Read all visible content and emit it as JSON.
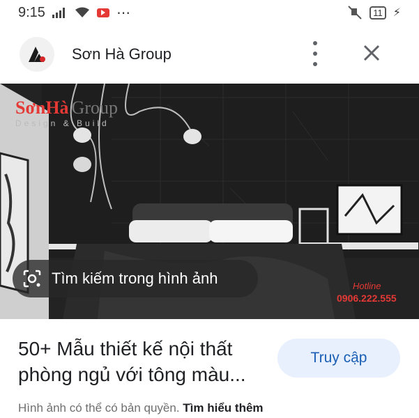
{
  "status_bar": {
    "time": "9:15",
    "battery": "11"
  },
  "header": {
    "site_name": "Sơn Hà Group"
  },
  "image": {
    "brand_text": "SơnHà",
    "brand_suffix": "Group",
    "brand_tagline": "Design & Build",
    "hotline_label": "Hotline",
    "hotline_number": "0906.222.555"
  },
  "lens": {
    "label": "Tìm kiếm trong hình ảnh"
  },
  "result": {
    "title_line1": "50+ Mẫu thiết kế nội thất",
    "title_line2": "phòng ngủ với tông màu...",
    "visit_label": "Truy cập",
    "copyright_text": "Hình ảnh có thể có bản quyền.",
    "learn_more": "Tìm hiểu thêm"
  }
}
